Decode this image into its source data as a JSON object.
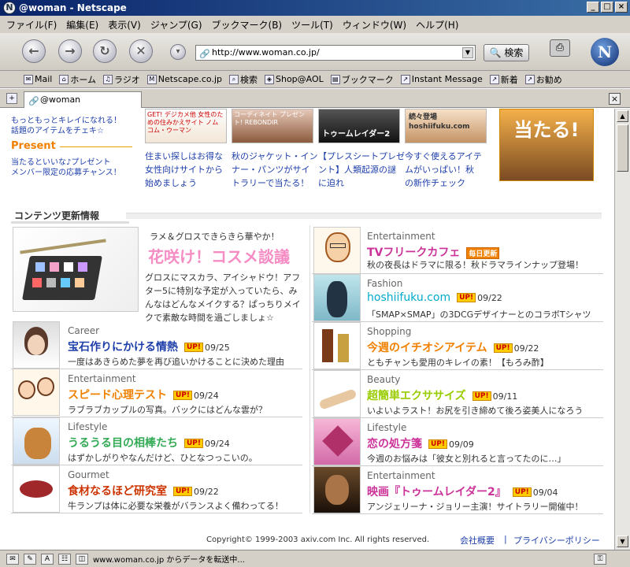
{
  "window": {
    "title": "@woman - Netscape"
  },
  "menu": [
    "ファイル(F)",
    "編集(E)",
    "表示(V)",
    "ジャンプ(G)",
    "ブックマーク(B)",
    "ツール(T)",
    "ウィンドウ(W)",
    "ヘルプ(H)"
  ],
  "nav": {
    "url": "http://www.woman.co.jp/",
    "search_label": "検索"
  },
  "personal_toolbar": [
    "Mail",
    "ホーム",
    "ラジオ",
    "Netscape.co.jp",
    "検索",
    "Shop@AOL",
    "ブックマーク",
    "Instant Message",
    "新着",
    "お勧め"
  ],
  "tab": {
    "label": "@woman"
  },
  "side": {
    "line1": "もっともっとキレイになれる！",
    "line2": "話題のアイテムをチェキ☆",
    "present_heading": "Present",
    "line3": "当たるといいな♪プレゼント",
    "line4": "メンバー限定の応募チャンス！"
  },
  "banners": [
    {
      "img_text": "GET! デジカメ他 女性のための住みかえサイト ノムコム・ウーマン",
      "l1": "住まい探しはお得な",
      "l2": "女性向けサイトから",
      "l3": "始めましょう"
    },
    {
      "img_text": "コーディネイト プレゼント! REBONDIR",
      "l1": "秋のジャケット・イン",
      "l2": "ナー・パンツがサイ",
      "l3": "トラリーで当たる！"
    },
    {
      "img_text": "トゥームレイダー2",
      "l1": "【プレスシートプレゼ",
      "l2": "ント】人類起源の謎",
      "l3": "に迫れ"
    },
    {
      "img_text": "続々登場 hoshiifuku.com",
      "l1": "今すぐ使えるアイテ",
      "l2": "ムがいっぱい！秋",
      "l3": "の新作チェック"
    },
    {
      "img_text": "当たる!"
    }
  ],
  "section": {
    "heading": "コンテンツ更新情報"
  },
  "feature": {
    "lead": "ラメ＆グロスできらきら華やか！",
    "title": "花咲け！コスメ談議",
    "d1": "グロスにマスカラ、アイシャドウ！アフ",
    "d2": "ター5に特別な予定が入っていたら、み",
    "d3": "んなはどんなメイクする？ぱっちりメイ",
    "d4": "クで素敵な時間を過ごしましょ☆"
  },
  "right_top": {
    "category": "Entertainment",
    "title": "TVフリークカフェ",
    "badge": "毎日更新",
    "desc": "秋の夜長はドラマに限る！秋ドラマラインナップ登場！"
  },
  "left_entries": [
    {
      "category": "Career",
      "title": "宝石作りにかける情熱",
      "up": "UP!",
      "date": "09/25",
      "desc": "一度はあきらめた夢を再び追いかけることに決めた理由",
      "color": "#1e3faa"
    },
    {
      "category": "Entertainment",
      "title": "スピード心理テスト",
      "up": "UP!",
      "date": "09/24",
      "desc": "ラブラブカップルの写真。バックにはどんな雲が？",
      "color": "#f08000"
    },
    {
      "category": "Lifestyle",
      "title": "うるうる目の相棒たち",
      "up": "UP!",
      "date": "09/24",
      "desc": "はずかしがりやなんだけど、ひとなつっこいの。",
      "color": "#33aa55"
    },
    {
      "category": "Gourmet",
      "title": "食材なるほど研究室",
      "up": "UP!",
      "date": "09/22",
      "desc": "牛ランプは体に必要な栄養がバランスよく備わってる！",
      "color": "#cc3300"
    }
  ],
  "right_entries": [
    {
      "category": "Fashion",
      "title": "hoshiifuku.com",
      "up": "UP!",
      "date": "09/22",
      "desc": "「SMAP×SMAP」の3DCGデザイナーとのコラボTシャツ",
      "color": "#00aacc"
    },
    {
      "category": "Shopping",
      "title": "今週のイチオシアイテム",
      "up": "UP!",
      "date": "09/22",
      "desc": "ともチャンも愛用のキレイの素！【もろみ酢】",
      "color": "#f08000"
    },
    {
      "category": "Beauty",
      "title": "超簡単エクササイズ",
      "up": "UP!",
      "date": "09/11",
      "desc": "いよいよラスト！お尻を引き締めて後ろ姿美人になろう",
      "color": "#99cc00"
    },
    {
      "category": "Lifestyle",
      "title": "恋の処方箋",
      "up": "UP!",
      "date": "09/09",
      "desc": "今週のお悩みは「彼女と別れると言ってたのに…」",
      "color": "#cc3399"
    },
    {
      "category": "Entertainment",
      "title": "映画『トゥームレイダー2』",
      "up": "UP!",
      "date": "09/04",
      "desc": "アンジェリーナ・ジョリー主演！サイトラリー開催中！",
      "color": "#cc3399"
    }
  ],
  "footer": {
    "copyright": "Copyright© 1999-2003 axiv.com Inc. All rights reserved.",
    "company": "会社概要",
    "divider": "|",
    "privacy": "プライバシーポリシー"
  },
  "status": {
    "text": "www.woman.co.jp からデータを転送中..."
  }
}
